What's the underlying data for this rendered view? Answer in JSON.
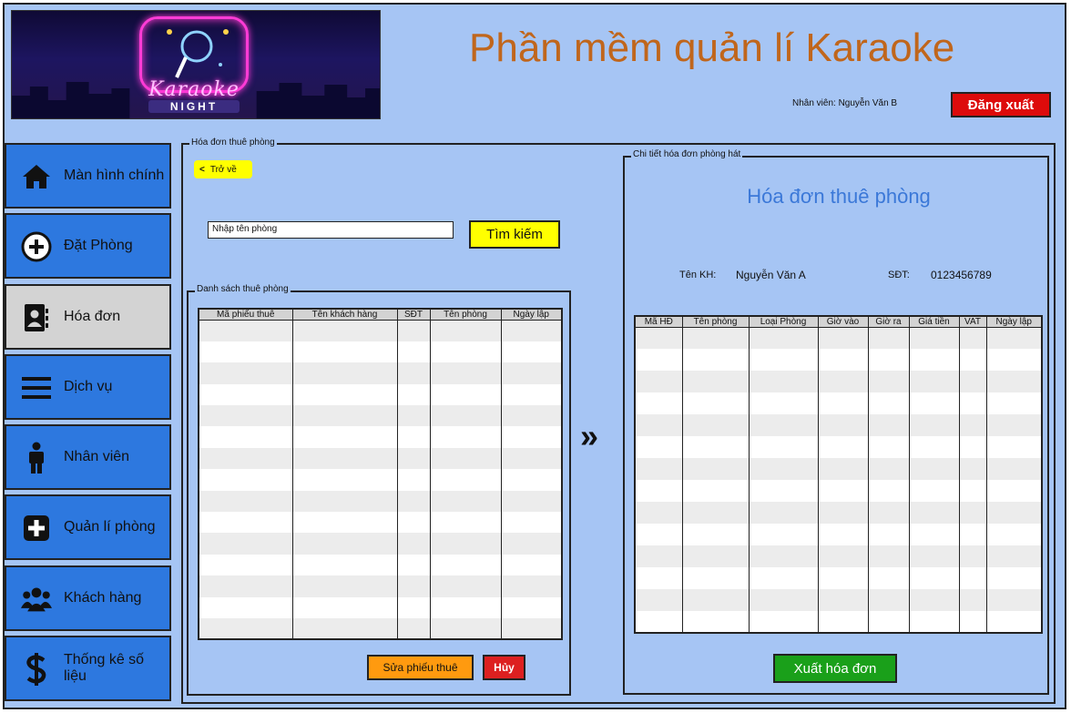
{
  "app": {
    "title": "Phần mềm quản lí Karaoke",
    "staff_label": "Nhân viên: Nguyễn Văn B",
    "logout_label": "Đăng xuất"
  },
  "banner": {
    "neon_text": "Karaoke",
    "neon_sub": "NIGHT"
  },
  "sidebar": {
    "items": [
      {
        "label": "Màn hình chính",
        "icon": "home-icon"
      },
      {
        "label": "Đặt Phòng",
        "icon": "plus-circle-icon"
      },
      {
        "label": "Hóa đơn",
        "icon": "contact-book-icon",
        "active": true
      },
      {
        "label": "Dịch vụ",
        "icon": "menu-icon"
      },
      {
        "label": "Nhân viên",
        "icon": "person-icon"
      },
      {
        "label": "Quản lí phòng",
        "icon": "plus-square-icon"
      },
      {
        "label": "Khách hàng",
        "icon": "users-icon"
      },
      {
        "label": "Thống kê số liệu",
        "icon": "dollar-icon"
      }
    ]
  },
  "main": {
    "group_label": "Hóa đơn thuê phòng",
    "back_label": "Trở về",
    "search_value": "Nhập tên phòng",
    "search_button": "Tìm kiếm",
    "list_group_label": "Danh sách thuê phòng",
    "list_columns": [
      "Mã phiếu thuê",
      "Tên khách hàng",
      "SĐT",
      "Tên phòng",
      "Ngày lập"
    ],
    "edit_button": "Sửa phiếu thuê",
    "cancel_button": "Hủy",
    "transfer_arrow": "»"
  },
  "detail": {
    "group_label": "Chi tiết hóa đơn phòng hát",
    "title": "Hóa đơn thuê phòng",
    "customer_label": "Tên KH:",
    "customer_value": "Nguyễn Văn A",
    "phone_label": "SĐT:",
    "phone_value": "0123456789",
    "columns": [
      "Mã HĐ",
      "Tên phòng",
      "Loại Phòng",
      "Giờ vào",
      "Giờ ra",
      "Giá tiền",
      "VAT",
      "Ngày lập"
    ],
    "export_button": "Xuất hóa đơn"
  },
  "colors": {
    "background": "#a6c5f4",
    "title": "#c0661c",
    "sidebar": "#2d78df",
    "sidebar_active": "#d3d3d3",
    "logout": "#dd0b0b",
    "search": "#ffff00",
    "edit": "#ff9a0f",
    "export": "#1aa01a",
    "invoice_title": "#3b78d8"
  }
}
